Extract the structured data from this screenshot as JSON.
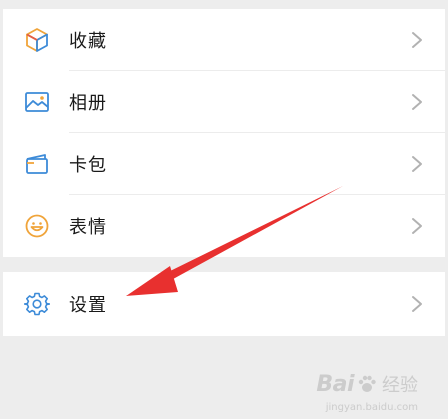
{
  "menu": {
    "items": [
      {
        "label": "收藏",
        "icon": "favorites-cube-icon"
      },
      {
        "label": "相册",
        "icon": "album-image-icon"
      },
      {
        "label": "卡包",
        "icon": "card-wallet-icon"
      },
      {
        "label": "表情",
        "icon": "smiley-face-icon"
      }
    ],
    "settings": {
      "label": "设置",
      "icon": "gear-icon"
    }
  },
  "watermark": {
    "brand": "Bai",
    "brand_tail": "du",
    "suffix": "经验",
    "url": "jingyan.baidu.com"
  },
  "colors": {
    "background": "#ededed",
    "row_bg": "#ffffff",
    "text": "#1a1a1a",
    "chevron": "#b2b2b2",
    "icon_blue": "#3d8bd8",
    "icon_orange": "#f0a43a",
    "arrow_red": "#e8302f"
  }
}
